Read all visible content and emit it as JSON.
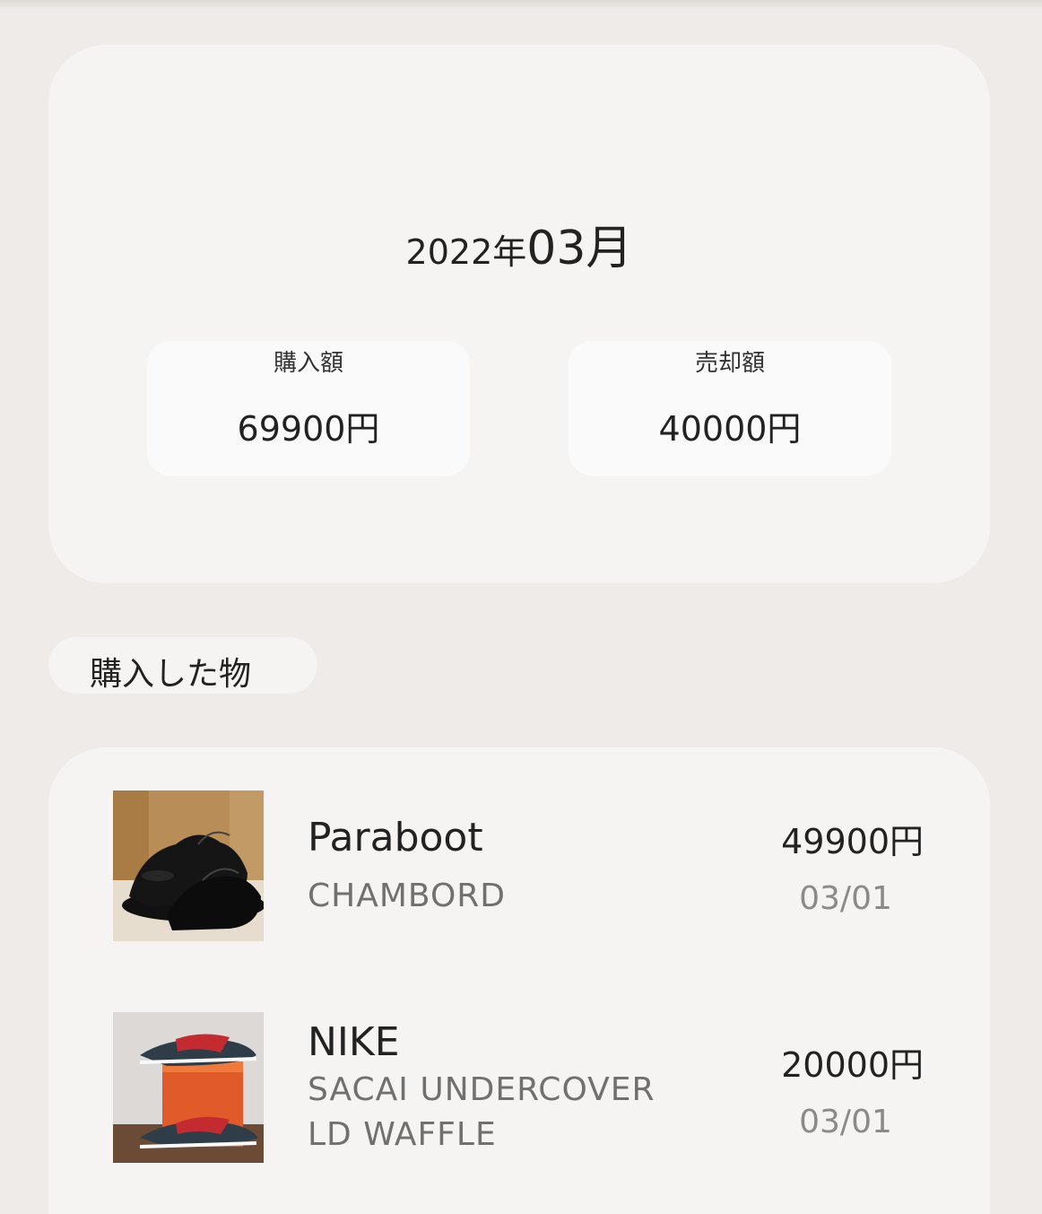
{
  "summary": {
    "year": "2022年",
    "month": "03月",
    "purchase_label": "購入額",
    "purchase_value": "69900円",
    "sales_label": "売却額",
    "sales_value": "40000円"
  },
  "section": {
    "title": "購入した物"
  },
  "items": [
    {
      "brand": "Paraboot",
      "model": "CHAMBORD",
      "price": "49900円",
      "date": "03/01",
      "image": "black-leather-shoes"
    },
    {
      "brand": "NIKE",
      "model": "SACAI UNDERCOVER LD WAFFLE",
      "price": "20000円",
      "date": "03/01",
      "image": "sneakers-with-orange-box"
    }
  ]
}
